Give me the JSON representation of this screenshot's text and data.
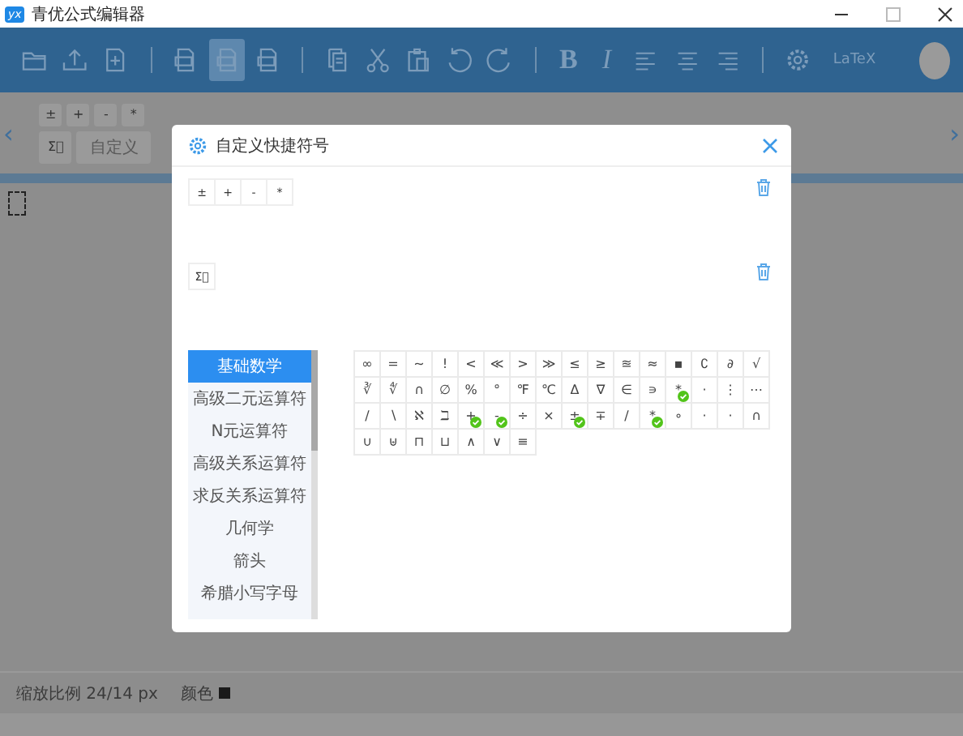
{
  "window": {
    "title": "青优公式编辑器",
    "app_icon": "yx"
  },
  "toolbar": [
    {
      "kind": "folder"
    },
    {
      "kind": "upload"
    },
    {
      "kind": "new"
    },
    {
      "kind": "sep"
    },
    {
      "kind": "export",
      "selected": false
    },
    {
      "kind": "export",
      "selected": true
    },
    {
      "kind": "export",
      "selected": false
    },
    {
      "kind": "sep"
    },
    {
      "kind": "copy"
    },
    {
      "kind": "cut"
    },
    {
      "kind": "paste"
    },
    {
      "kind": "undo"
    },
    {
      "kind": "redo"
    },
    {
      "kind": "sep"
    },
    {
      "kind": "bold",
      "text": "B"
    },
    {
      "kind": "italic",
      "text": "I"
    },
    {
      "kind": "align-left"
    },
    {
      "kind": "align-center"
    },
    {
      "kind": "align-right"
    },
    {
      "kind": "sep"
    },
    {
      "kind": "gear"
    },
    {
      "kind": "latex",
      "text": "LaTeX"
    },
    {
      "kind": "avatar"
    }
  ],
  "shortcut_bar": {
    "prev": "‹",
    "next": "›",
    "symbols": [
      "±",
      "+",
      "-",
      "*"
    ],
    "sum": "Σ⃞",
    "custom": "自定义"
  },
  "dialog": {
    "title": "自定义快捷符号",
    "groups": [
      {
        "symbols": [
          "±",
          "+",
          "-",
          "*"
        ]
      },
      {
        "symbols": [
          "Σ⃞"
        ]
      }
    ],
    "categories": [
      {
        "label": "基础数学",
        "selected": true
      },
      {
        "label": "高级二元运算符",
        "selected": false
      },
      {
        "label": "N元运算符",
        "selected": false
      },
      {
        "label": "高级关系运算符",
        "selected": false
      },
      {
        "label": "求反关系运算符",
        "selected": false
      },
      {
        "label": "几何学",
        "selected": false
      },
      {
        "label": "箭头",
        "selected": false
      },
      {
        "label": "希腊小写字母",
        "selected": false
      }
    ],
    "symbols": [
      {
        "s": "∞",
        "selected": false
      },
      {
        "s": "=",
        "selected": false
      },
      {
        "s": "~",
        "selected": false
      },
      {
        "s": "!",
        "selected": false
      },
      {
        "s": "<",
        "selected": false
      },
      {
        "s": "≪",
        "selected": false
      },
      {
        "s": ">",
        "selected": false
      },
      {
        "s": "≫",
        "selected": false
      },
      {
        "s": "≤",
        "selected": false
      },
      {
        "s": "≥",
        "selected": false
      },
      {
        "s": "≊",
        "selected": false
      },
      {
        "s": "≈",
        "selected": false
      },
      {
        "s": "▪",
        "selected": false
      },
      {
        "s": "∁",
        "selected": false
      },
      {
        "s": "∂",
        "selected": false
      },
      {
        "s": "√",
        "selected": false
      },
      {
        "s": "∛",
        "selected": false
      },
      {
        "s": "∜",
        "selected": false
      },
      {
        "s": "∩",
        "selected": false
      },
      {
        "s": "∅",
        "selected": false
      },
      {
        "s": "%",
        "selected": false
      },
      {
        "s": "°",
        "selected": false
      },
      {
        "s": "℉",
        "selected": false
      },
      {
        "s": "℃",
        "selected": false
      },
      {
        "s": "Δ",
        "selected": false
      },
      {
        "s": "∇",
        "selected": false
      },
      {
        "s": "∈",
        "selected": false
      },
      {
        "s": "∍",
        "selected": false
      },
      {
        "s": "*",
        "selected": true
      },
      {
        "s": "·",
        "selected": false
      },
      {
        "s": "⋮",
        "selected": false
      },
      {
        "s": "⋯",
        "selected": false
      },
      {
        "s": "∕",
        "selected": false
      },
      {
        "s": "∖",
        "selected": false
      },
      {
        "s": "ℵ",
        "selected": false
      },
      {
        "s": "ℶ",
        "selected": false
      },
      {
        "s": "+",
        "selected": true
      },
      {
        "s": "-",
        "selected": true
      },
      {
        "s": "÷",
        "selected": false
      },
      {
        "s": "×",
        "selected": false
      },
      {
        "s": "±",
        "selected": true
      },
      {
        "s": "∓",
        "selected": false
      },
      {
        "s": "/",
        "selected": false
      },
      {
        "s": "*",
        "selected": true
      },
      {
        "s": "∘",
        "selected": false
      },
      {
        "s": "·",
        "selected": false
      },
      {
        "s": "·",
        "selected": false
      },
      {
        "s": "∩",
        "selected": false
      },
      {
        "s": "∪",
        "selected": false
      },
      {
        "s": "⊎",
        "selected": false
      },
      {
        "s": "⊓",
        "selected": false
      },
      {
        "s": "⊔",
        "selected": false
      },
      {
        "s": "∧",
        "selected": false
      },
      {
        "s": "∨",
        "selected": false
      },
      {
        "s": "≡",
        "selected": false
      }
    ]
  },
  "status_bar": {
    "zoom": "缩放比例 24/14 px",
    "color_label": "颜色",
    "color": "#1a1a1a"
  }
}
